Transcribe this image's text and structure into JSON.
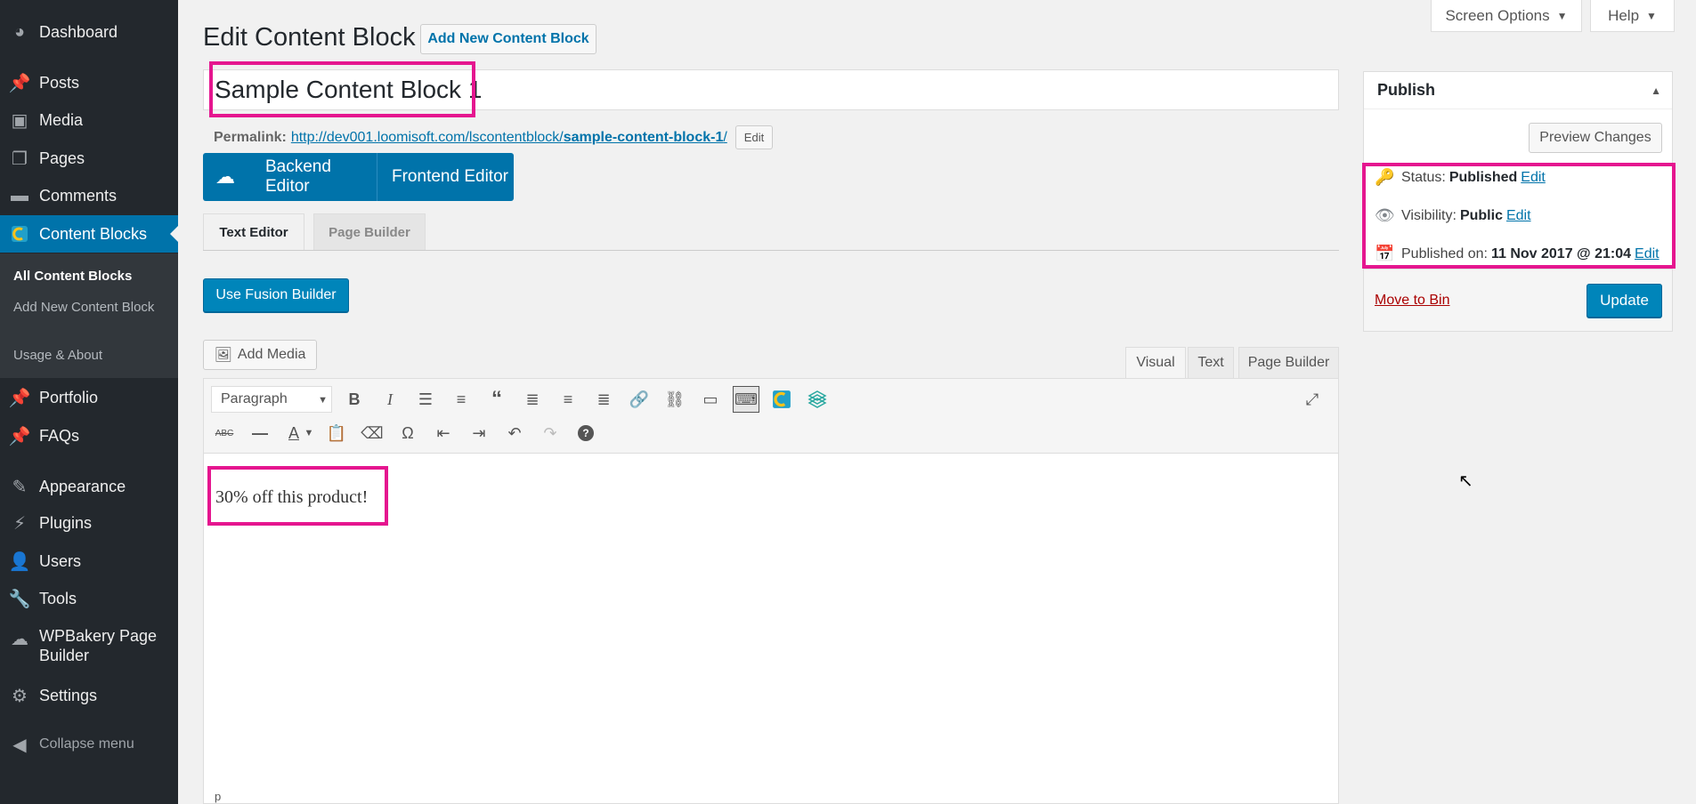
{
  "sidebar": {
    "items": [
      {
        "label": "Dashboard",
        "icon": "dashboard-icon"
      },
      {
        "label": "Posts",
        "icon": "pin-icon"
      },
      {
        "label": "Media",
        "icon": "media-icon"
      },
      {
        "label": "Pages",
        "icon": "pages-icon"
      },
      {
        "label": "Comments",
        "icon": "comment-icon"
      },
      {
        "label": "Content Blocks",
        "icon": "content-blocks-icon"
      },
      {
        "label": "Portfolio",
        "icon": "pin-icon"
      },
      {
        "label": "FAQs",
        "icon": "pin-icon"
      },
      {
        "label": "Appearance",
        "icon": "brush-icon"
      },
      {
        "label": "Plugins",
        "icon": "plugin-icon"
      },
      {
        "label": "Users",
        "icon": "user-icon"
      },
      {
        "label": "Tools",
        "icon": "wrench-icon"
      },
      {
        "label": "WPBakery Page Builder",
        "icon": "cloud-icon"
      },
      {
        "label": "Settings",
        "icon": "settings-icon"
      }
    ],
    "submenu": [
      "All Content Blocks",
      "Add New Content Block",
      "Usage & About"
    ],
    "collapse_label": "Collapse menu"
  },
  "header": {
    "title": "Edit Content Block",
    "add_new_label": "Add New Content Block",
    "screen_options_label": "Screen Options",
    "help_label": "Help"
  },
  "post": {
    "title": "Sample Content Block 1",
    "permalink_label": "Permalink:",
    "permalink_base": "http://dev001.loomisoft.com/lscontentblock/",
    "permalink_slug": "sample-content-block-1",
    "permalink_trail": "/",
    "permalink_edit_label": "Edit"
  },
  "builder": {
    "backend_label": "Backend Editor",
    "frontend_label": "Frontend Editor",
    "tabs": [
      "Text Editor",
      "Page Builder"
    ],
    "fusion_label": "Use Fusion Builder"
  },
  "editor": {
    "add_media_label": "Add Media",
    "mode_tabs": [
      "Visual",
      "Text",
      "Page Builder"
    ],
    "format_select": "Paragraph",
    "content": "30% off this product!",
    "path": "p"
  },
  "publish": {
    "title": "Publish",
    "preview_label": "Preview Changes",
    "status_label": "Status:",
    "status_value": "Published",
    "visibility_label": "Visibility:",
    "visibility_value": "Public",
    "published_label": "Published on:",
    "published_value": "11 Nov 2017 @ 21:04",
    "edit_link": "Edit",
    "trash_label": "Move to Bin",
    "update_label": "Update"
  },
  "colors": {
    "accent": "#0073aa",
    "highlight": "#e5168f",
    "sidebar_bg": "#23282d"
  }
}
